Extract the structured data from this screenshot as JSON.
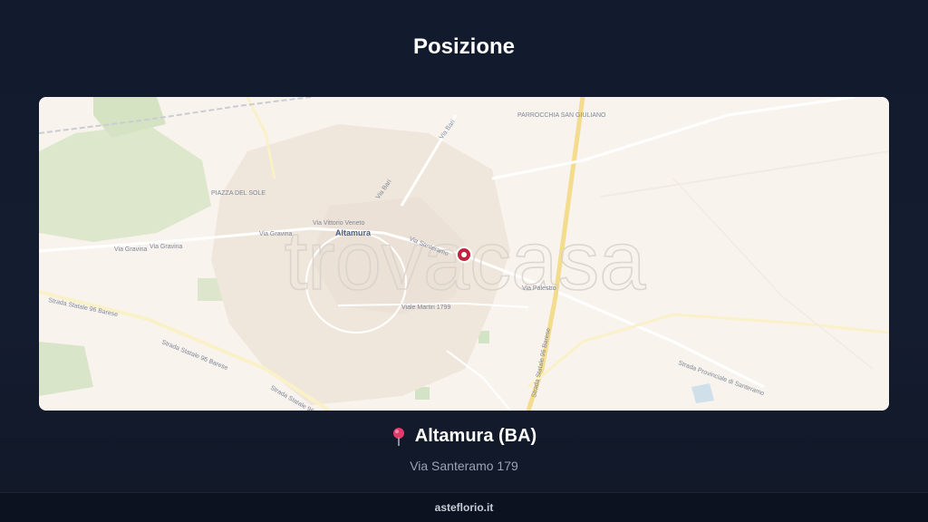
{
  "header": {
    "title": "Posizione"
  },
  "map": {
    "watermark": "trovacasa",
    "city_label": "Altamura",
    "place_label": "PIAZZA DEL SOLE",
    "poi_label": "PARROCCHIA SAN GIULIANO",
    "road_labels": {
      "via_gravina_1": "Via Gravina",
      "via_gravina_2": "Via Gravina",
      "via_gravina_3": "Via Gravina",
      "via_vittorio_veneto": "Via Vittorio Veneto",
      "via_bari_1": "Via Bari",
      "via_bari_2": "Via Bari",
      "via_santeramo": "Via Santeramo",
      "viale_martiri": "Viale Martiri 1799",
      "via_palestro": "Via Palestro",
      "strada_statale_96_1": "Strada Statale 96 Barese",
      "strada_statale_96_2": "Strada Statale 96 Barese",
      "strada_statale_96_3": "Strada Statale 96 Barese",
      "strada_statale_96_4": "Strada Statale 96 Barese",
      "strada_provinciale": "Strada Provinciale di Santeramo"
    },
    "marker_color": "#c0233b"
  },
  "location": {
    "city": "Altamura (BA)",
    "address": "Via Santeramo 179",
    "pin_icon": "map-pin-icon"
  },
  "footer": {
    "site": "asteflorio.it"
  }
}
